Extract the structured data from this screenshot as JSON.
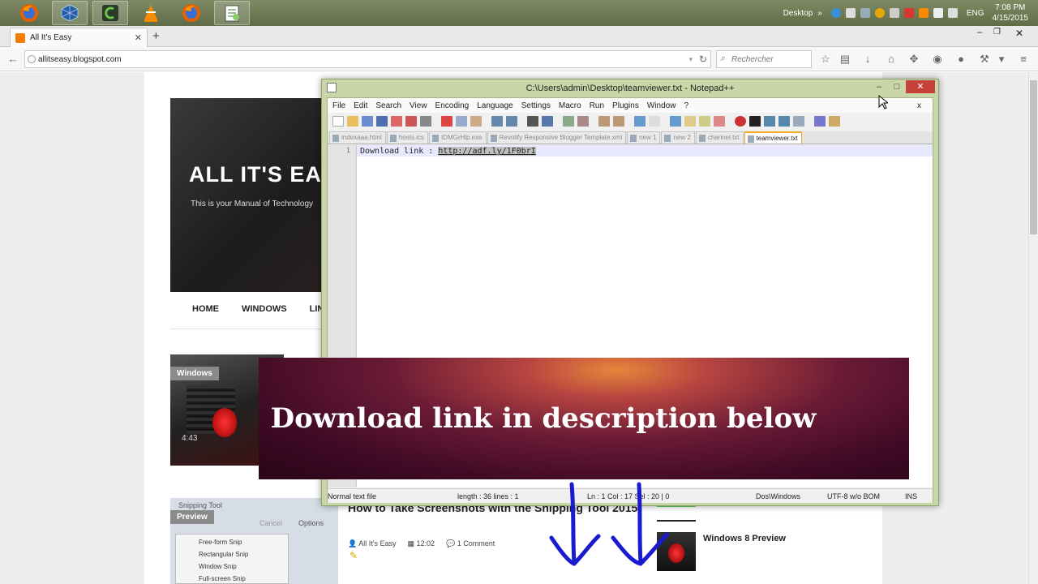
{
  "taskbar": {
    "apps": [
      "firefox-icon",
      "virtualbox-icon",
      "camtasia-icon",
      "vlc-icon",
      "firefox-icon",
      "notepadpp-icon"
    ],
    "desktop_label": "Desktop",
    "lang": "ENG",
    "time": "7:08 PM",
    "date": "4/15/2015"
  },
  "browser": {
    "tab_title": "All It's Easy",
    "url": "allitseasy.blogspot.com",
    "search_placeholder": "Rechercher"
  },
  "blog": {
    "title": "ALL IT'S EASY",
    "tagline": "This is your Manual of Technology",
    "menu": [
      "HOME",
      "WINDOWS",
      "LINUX"
    ],
    "label_windows": "Windows",
    "video_time": "4:43",
    "label_preview": "Preview",
    "post_title": "How to Take Screenshots with the Snipping Tool 2015",
    "post_author": "All It's Easy",
    "post_time": "12:02",
    "post_comments": "1 Comment",
    "side_title": "Windows 8 Preview",
    "snip_menu": [
      "Free-form Snip",
      "Rectangular Snip",
      "Window Snip",
      "Full-screen Snip"
    ],
    "snip_header": "Snipping Tool",
    "snip_cancel": "Cancel",
    "snip_options": "Options"
  },
  "notepad": {
    "title": "C:\\Users\\admin\\Desktop\\teamviewer.txt - Notepad++",
    "menu": [
      "File",
      "Edit",
      "Search",
      "View",
      "Encoding",
      "Language",
      "Settings",
      "Macro",
      "Run",
      "Plugins",
      "Window",
      "?"
    ],
    "tabs": [
      "indexaaa.html",
      "hosts.ics",
      "IDMGrHlp.exe",
      "Revolify Responsive Blogger Template.xml",
      "new 1",
      "new 2",
      "channel.txt",
      "teamviewer.txt"
    ],
    "active_tab": 7,
    "line_number": "1",
    "code_prefix": "Download link : ",
    "code_link": "http://adf.ly/1F0brI",
    "status": {
      "type": "Normal text file",
      "length": "length : 36   lines : 1",
      "pos": "Ln : 1    Col : 17    Sel : 20 | 0",
      "eol": "Dos\\Windows",
      "encoding": "UTF-8 w/o BOM",
      "mode": "INS"
    }
  },
  "banner": {
    "text": "Download link in description below"
  },
  "colors": {
    "taskbar": "#6e7a55",
    "npp_frame": "#c8d6a8",
    "close_red": "#c7403a",
    "arrow_blue": "#1a1ad0"
  }
}
